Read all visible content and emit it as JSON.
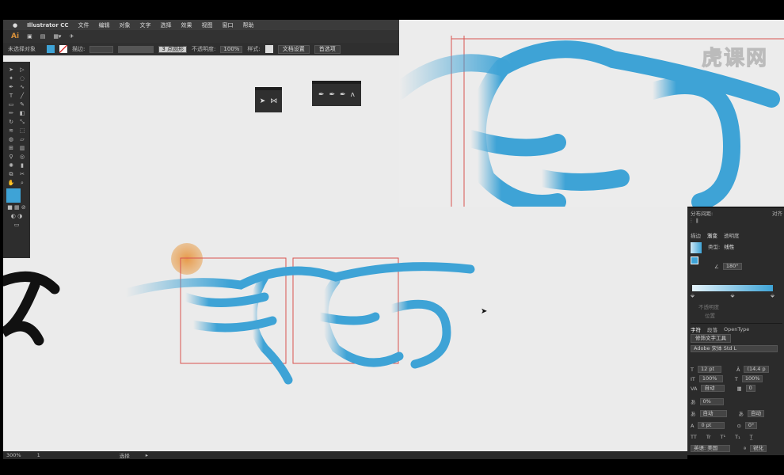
{
  "menubar": {
    "app": "Illustrator CC",
    "items": [
      "文件",
      "编辑",
      "对象",
      "文字",
      "选择",
      "效果",
      "视图",
      "窗口",
      "帮助"
    ]
  },
  "appbar": {
    "logo": "Ai"
  },
  "control_bar": {
    "selection": "未选择对象",
    "stroke_label": "描边:",
    "brush": "3 点圆形",
    "opacity_label": "不透明度:",
    "opacity": "100%",
    "style_label": "样式:",
    "doc_setup": "文档设置",
    "preferences": "首选项"
  },
  "colors": {
    "accent": "#3ea3d6",
    "sun": "#e89a4a",
    "guide": "#d9534f"
  },
  "watermark": "虎课网",
  "right_panel": {
    "distribute_title": "分布间距:",
    "align_title": "对齐",
    "tabs": [
      "描边",
      "渐变",
      "透明度"
    ],
    "gradient_type_label": "类型:",
    "gradient_type": "线性",
    "angle": "180°",
    "opacity_label": "不透明度",
    "position_label": "位置",
    "char_tabs": [
      "字符",
      "段落",
      "OpenType"
    ],
    "touch_type": "修饰文字工具",
    "font": "Adobe 宋体 Std L",
    "size": "12 pt",
    "leading": "(14.4 p",
    "vscale": "100%",
    "hscale": "100%",
    "kerning": "自动",
    "tracking": "0",
    "tsume": "0%",
    "aki_left": "自动",
    "aki_right": "自动",
    "baseline": "0 pt",
    "rotation": "0°",
    "lang": "英语: 美国",
    "aa": "锐化"
  },
  "status": {
    "zoom": "300%",
    "page": "1",
    "tool": "选择"
  }
}
